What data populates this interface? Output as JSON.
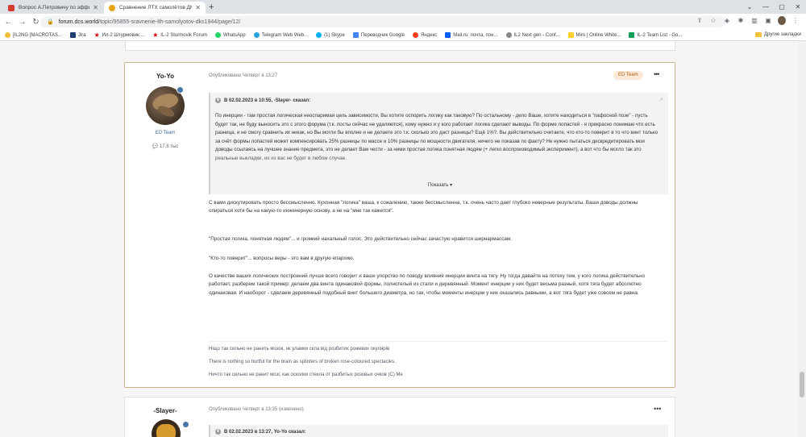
{
  "browser": {
    "tabs": [
      {
        "title": "Вопрос А.Петровичу по эффект...",
        "active": false
      },
      {
        "title": "Сравнение ЛТХ самолётов ДКС...",
        "active": true
      }
    ],
    "url_host": "forum.dcs.world",
    "url_path": "/topic/95855-sravnenie-lth-samolyotov-dks1944/page/12/",
    "bookmarks": [
      "[IL2NG [MACROTAS...",
      "Jira",
      "Ил-2 Штурмовик:...",
      "IL-2 Sturmovik Forum",
      "WhatsApp",
      "Telegram Web Web...",
      "(1) Skype",
      "Переводчик Google",
      "Яндекс",
      "Mail.ru: почта, пои...",
      "IL2 Next gen - Conf...",
      "Miro | Online White...",
      "IL-2 Team List - Go..."
    ],
    "other_bookmarks": "Другие закладки"
  },
  "post1": {
    "author": "Yo-Yo",
    "group": "ED Team",
    "posts_count": "17,6 тыс",
    "meta": "Опубликовано Четверг в 13:27",
    "badge": "ED Team",
    "more": "•••",
    "quote_header": "В 02.02.2023 в 10:55, -Slayer- сказал:",
    "quote_text": "По инерции - там простая логическая неоспаримая цель зависимости, Вы хотите оспорить логику как таковую? По остальному - дело Ваше, хотите находиться в \"пафосной позе\" - пусть будет так, не буду выносить это с этого форума (т.к. посты сейчас не удаляются), кому нужно и у кого работает логика сделают выводы. По форме лопастей - я прекрасно понимаю что есть разница, и не смогу сравнить их никак, но Вы могли бы вполне и не делаете это т.к. сколько это даст разницы? Ещё 1%?. Вы действительно считаете, что кто-то поверит в то что винт только за счёт формы лопастей может компенсировать 25% разницы по массе и 10% разницы по мощности двигателя, ничего не показав по факту? Не нужно пытаться дискредитировать мои доводы ссылаясь на лучшее знание предмета, это не делает Вам чести - за ними простая логика понятная людям (+ легко воспроизводимый эксперимент), а вот что бы могло так это реальные выкладки, их из вас не будет в любом случае.",
    "quote_expand": "Показать",
    "paragraphs": [
      "С вами дискутировать просто бессмысленно. Кухонная \"логика\" ваша, к сожалению, также бессмысленна, т.к. очень часто дает глубоко неверные результаты.  Ваши доводы должны опираться хотя бы на какую-то инженерную основу, а не на \"мне так кажется\".",
      "\"Простая логика, понятная людям\"... и громкий нахальный голос.  Это действительно сейчас зачастую нравится ширнармассам.",
      "\"Кто-то поверит\"...  вопросы веры - это вам в другую епархию.",
      "О качестве ваших логических построений лучше всего говорит и ваше упорство по поводу влияния инерции винта на тягу. Ну тогда давайте на потеху тем, у кого логика действительно работает, разберем такой пример: делаем два винта одинаковой формы, полнотелый из стали и деревянный. Момент инерции у них будет весьма разный, хотя тяга будет абсолютно одинаковая. И наоборот - сделаем деревянный подобный винт большего диаметра, но так, чтобы моменты инерции у них оказались равными, а вот тяга будет уже совсем не равна."
    ],
    "signature": [
      "Ніщо так сильно не ранить мозок, як уламки скла від розбитих рожевих окулярів",
      "There is nothing so hurtful for the brain as splinters of broken rose-coloured spectacles.",
      "Ничто так сильно не ранит мозг, как осколки стекла от разбитых розовых очков (С) Me"
    ]
  },
  "post2": {
    "author": "-Slayer-",
    "meta": "Опубликовано Четверг в 13:35 (изменено)",
    "more": "•••",
    "quote_header": "В 02.02.2023 в 13:27, Yo-Yo сказал:"
  }
}
